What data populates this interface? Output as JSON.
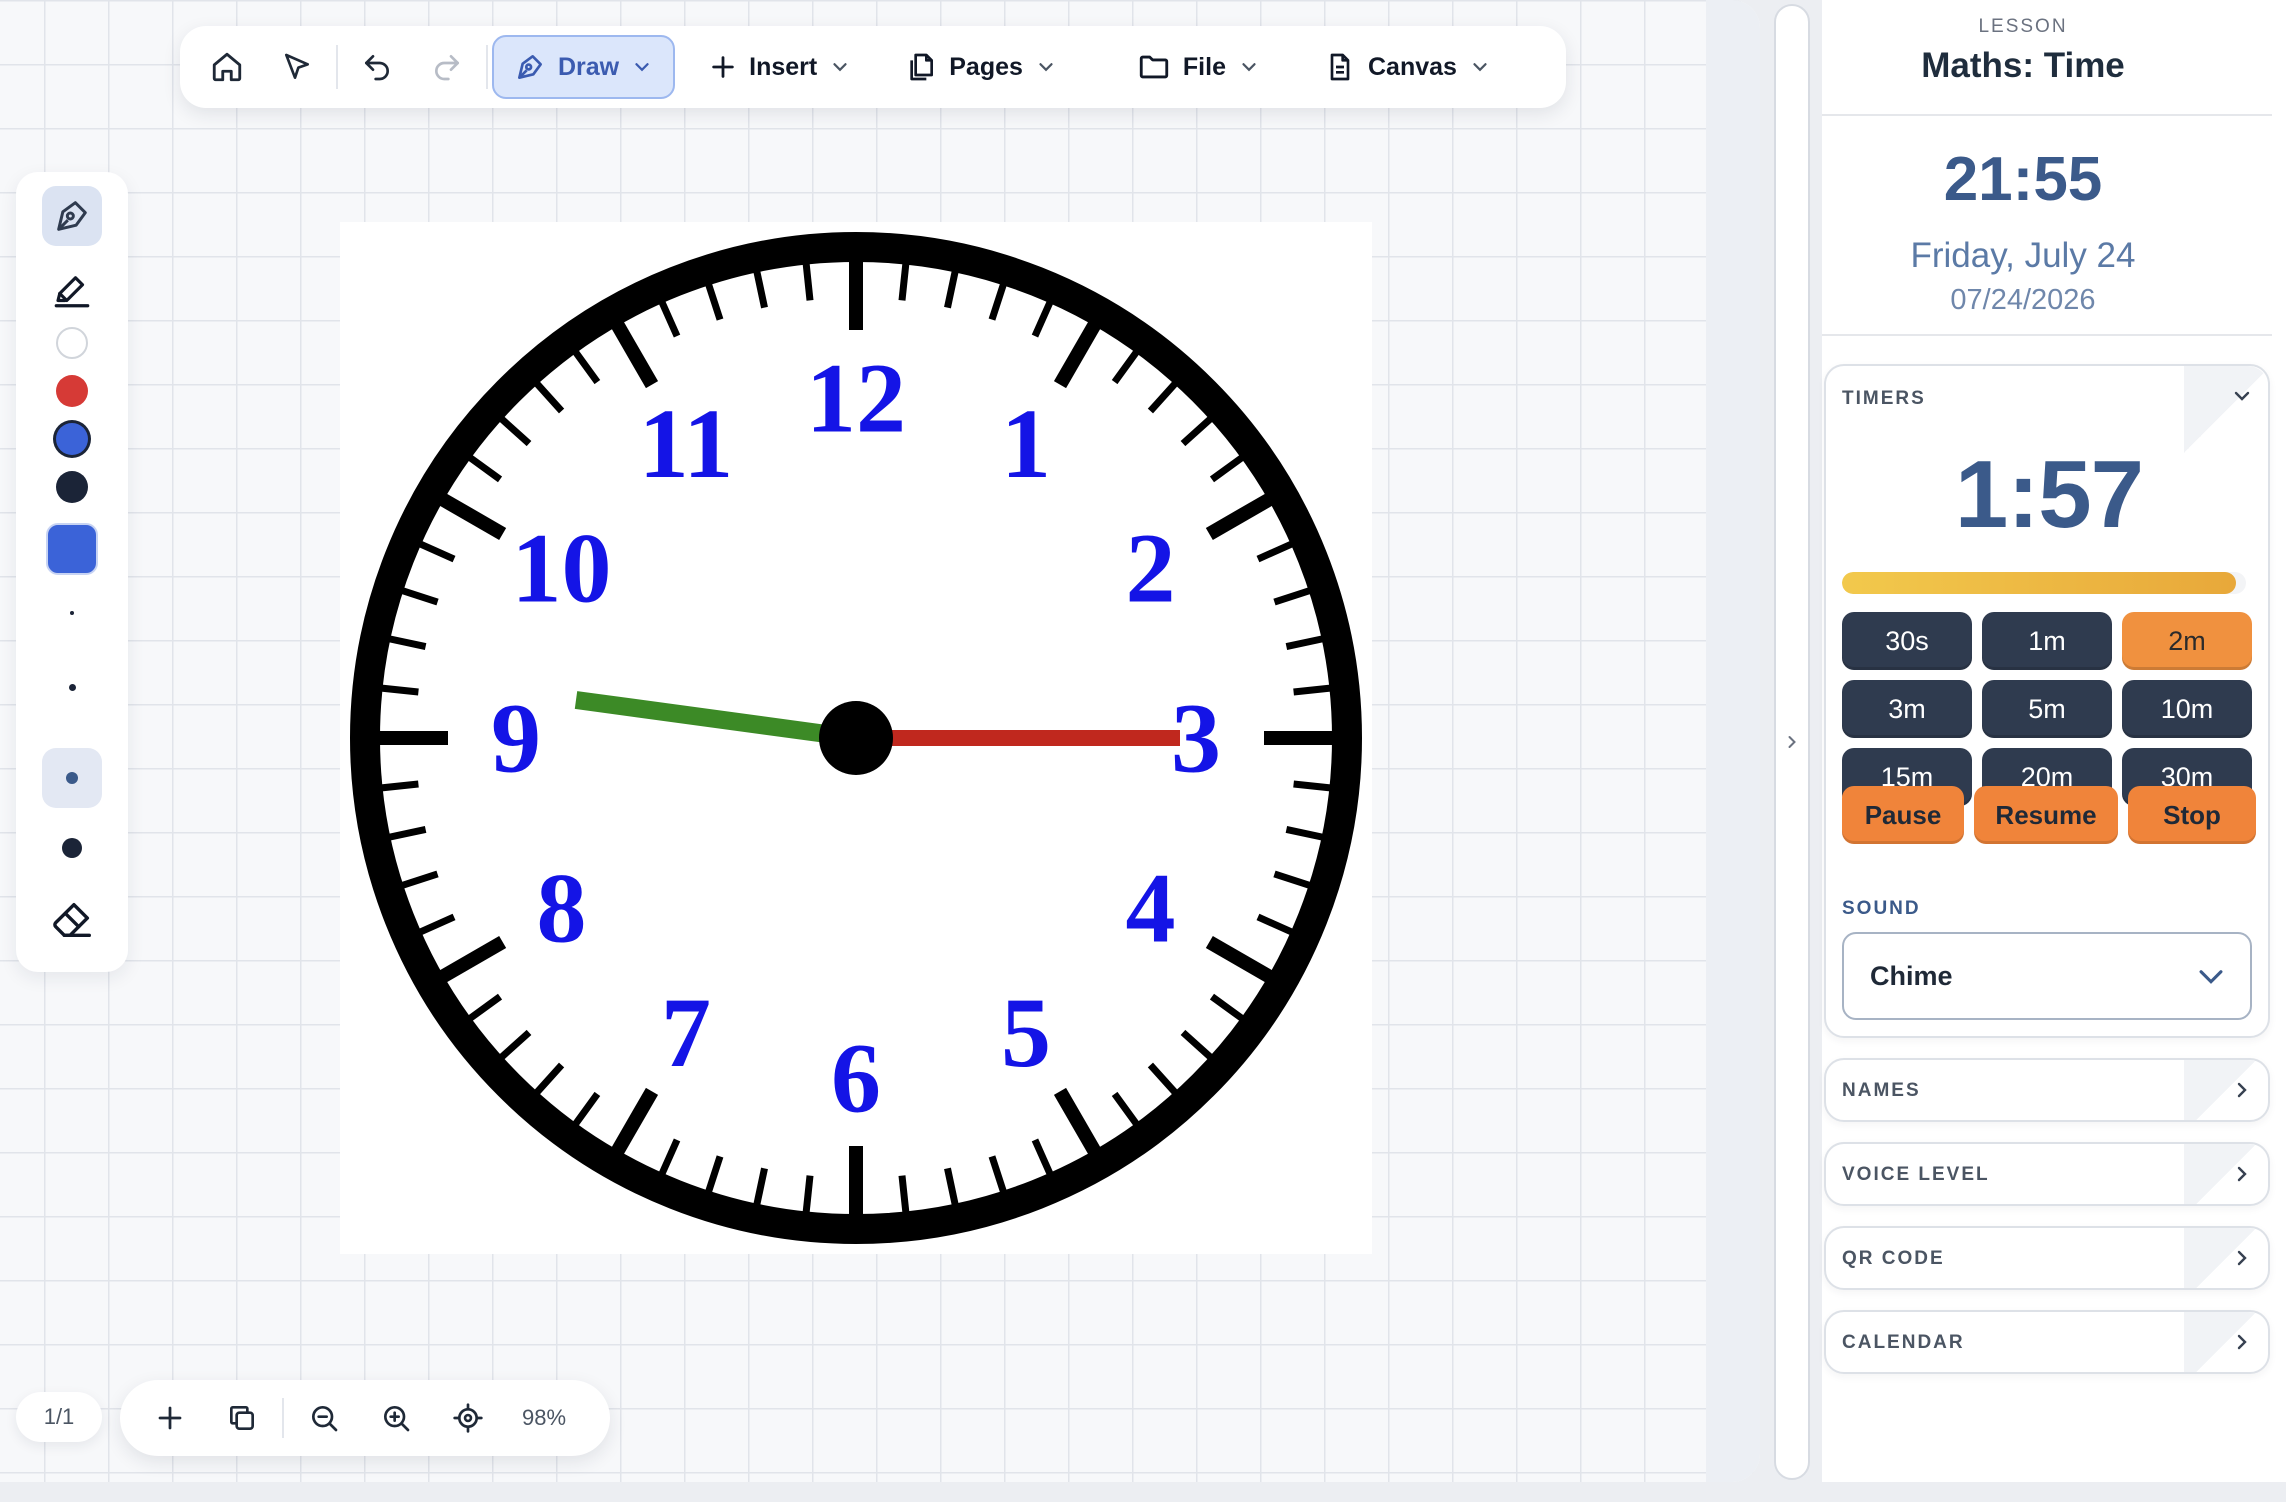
{
  "toolbar": {
    "draw_label": "Draw",
    "insert_label": "Insert",
    "pages_label": "Pages",
    "file_label": "File",
    "canvas_label": "Canvas"
  },
  "palette": {
    "colors": [
      "#ffffff",
      "#d63a36",
      "#3b63d8",
      "#1b2437"
    ],
    "fill_color": "#3b63d8"
  },
  "clock": {
    "numerals": [
      "12",
      "1",
      "2",
      "3",
      "4",
      "5",
      "6",
      "7",
      "8",
      "9",
      "10",
      "11"
    ],
    "numeral_color": "#1414e6",
    "hour_hand_color": "#3c8a26",
    "minute_hand_color": "#c0281e"
  },
  "bottom": {
    "page_counter": "1/1",
    "zoom": "98%"
  },
  "sidebar": {
    "lesson_caption": "LESSON",
    "lesson_title": "Maths: Time",
    "time": "21:55",
    "date": "Friday, July 24",
    "numeric_date": "07/24/2026",
    "timers": {
      "heading": "TIMERS",
      "display": "1:57",
      "progress_fraction": 0.975,
      "presets": [
        "30s",
        "1m",
        "2m",
        "3m",
        "5m",
        "10m",
        "15m",
        "20m",
        "30m"
      ],
      "active_preset": "2m",
      "pause": "Pause",
      "resume": "Resume",
      "stop": "Stop",
      "sound_label": "SOUND",
      "sound_value": "Chime"
    },
    "collapsed_panels": [
      "NAMES",
      "VOICE LEVEL",
      "QR CODE",
      "CALENDAR"
    ]
  },
  "colors": {
    "accent": "#3b5a8a",
    "orange": "#f0843a",
    "dark_button": "#2f3b4f"
  }
}
